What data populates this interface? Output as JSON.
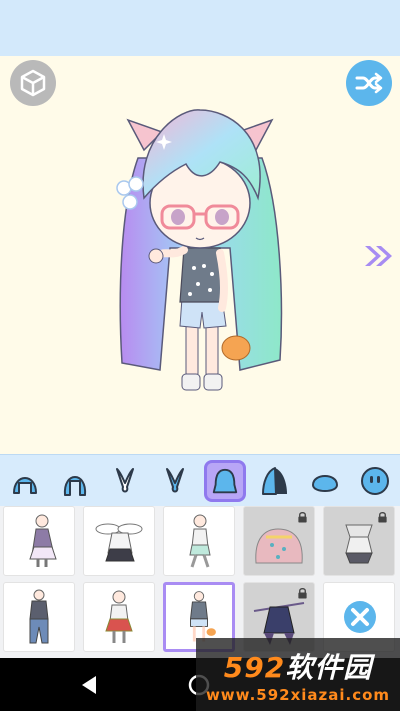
{
  "top_bar": {},
  "stage": {
    "left_button_icon": "cube-3d-icon",
    "right_button_icon": "shuffle-icon",
    "next_arrow_icon": "double-chevron-right-icon"
  },
  "tabs": [
    {
      "icon": "back-hair-icon",
      "active": false
    },
    {
      "icon": "back-hair-long-icon",
      "active": false
    },
    {
      "icon": "bunny-ears-icon",
      "active": false
    },
    {
      "icon": "bunny-ears-alt-icon",
      "active": false
    },
    {
      "icon": "outfit-body-icon",
      "active": true
    },
    {
      "icon": "side-hair-icon",
      "active": false
    },
    {
      "icon": "face-shape-icon",
      "active": false
    },
    {
      "icon": "face-eyes-icon",
      "active": false
    }
  ],
  "items": [
    {
      "name": "dress-outfit",
      "locked": false,
      "selected": false
    },
    {
      "name": "bunny-hoodie-outfit",
      "locked": false,
      "selected": false
    },
    {
      "name": "mint-outfit",
      "locked": false,
      "selected": false
    },
    {
      "name": "blob-costume-outfit",
      "locked": true,
      "selected": false
    },
    {
      "name": "sailor-outfit",
      "locked": true,
      "selected": false
    },
    {
      "name": "blue-jeans-outfit",
      "locked": false,
      "selected": false
    },
    {
      "name": "red-skirt-outfit",
      "locked": false,
      "selected": false
    },
    {
      "name": "tank-shorts-outfit",
      "locked": false,
      "selected": true
    },
    {
      "name": "dark-witch-outfit",
      "locked": true,
      "selected": false
    },
    {
      "name": "remove-outfit",
      "locked": false,
      "selected": false
    }
  ],
  "watermark": {
    "brand_number": "592",
    "brand_text": "软件园",
    "url": "www.592xiazai.com"
  },
  "colors": {
    "top_bar": "#d3e9fb",
    "stage_bg": "#fffbe9",
    "tab_bar": "#d7ebfc",
    "accent_purple": "#b8a6f6",
    "accent_blue": "#5cb6ec",
    "watermark_orange": "#ff8a1c"
  }
}
